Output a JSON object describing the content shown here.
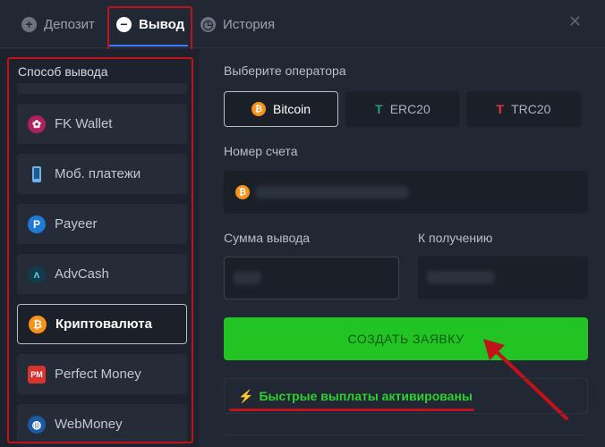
{
  "tabs": [
    {
      "label": "Депозит",
      "icon": "plus-icon",
      "active": false
    },
    {
      "label": "Вывод",
      "icon": "minus-icon",
      "active": true
    },
    {
      "label": "История",
      "icon": "clock-icon",
      "active": false
    }
  ],
  "sidebar": {
    "title": "Способ вывода",
    "methods": [
      {
        "label": "FK Wallet",
        "icon": "fk-wallet-icon",
        "active": false
      },
      {
        "label": "Моб. платежи",
        "icon": "phone-icon",
        "active": false
      },
      {
        "label": "Payeer",
        "icon": "payeer-icon",
        "active": false
      },
      {
        "label": "AdvCash",
        "icon": "advcash-icon",
        "active": false
      },
      {
        "label": "Криптовалюта",
        "icon": "bitcoin-icon",
        "active": true
      },
      {
        "label": "Perfect Money",
        "icon": "perfect-money-icon",
        "active": false
      },
      {
        "label": "WebMoney",
        "icon": "webmoney-icon",
        "active": false
      }
    ]
  },
  "main": {
    "operator_label": "Выберите оператора",
    "operators": [
      {
        "label": "Bitcoin",
        "icon": "bitcoin-icon",
        "active": true
      },
      {
        "label": "ERC20",
        "icon": "tether-icon",
        "active": false
      },
      {
        "label": "TRC20",
        "icon": "tron-icon",
        "active": false
      }
    ],
    "account_label": "Номер счета",
    "amount_label": "Сумма вывода",
    "receive_label": "К получению",
    "submit_label": "СОЗДАТЬ ЗАЯВКУ",
    "fast_payouts_text": "Быстрые выплаты активированы"
  },
  "colors": {
    "accent_green": "#21c423",
    "highlight_red": "#c0121a",
    "active_tab_underline": "#3b7bff",
    "bitcoin_orange": "#f7931a"
  }
}
